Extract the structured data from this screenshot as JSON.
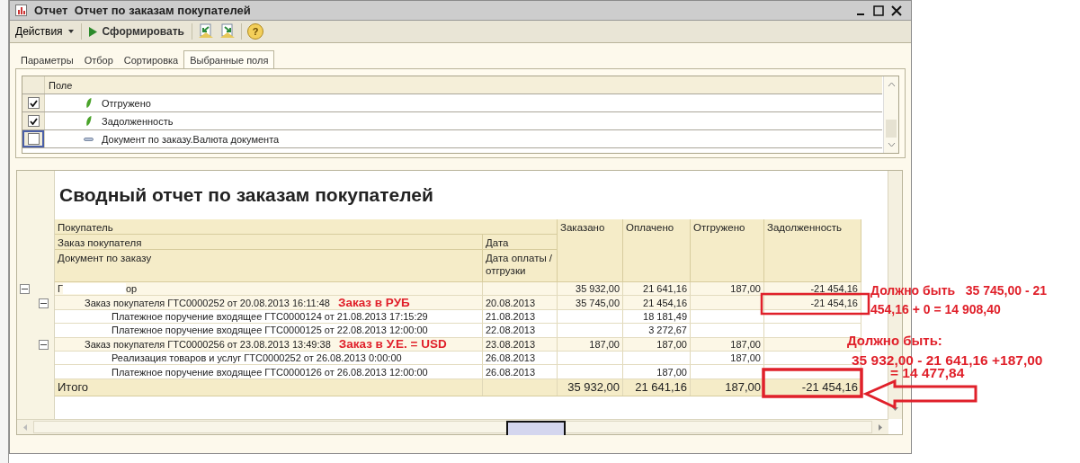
{
  "window": {
    "title": "Отчет  Отчет по заказам покупателей"
  },
  "toolbar": {
    "actions": "Действия",
    "generate": "Сформировать",
    "help": "?"
  },
  "tabs": [
    {
      "label": "Параметры",
      "selected": false
    },
    {
      "label": "Отбор",
      "selected": false
    },
    {
      "label": "Сортировка",
      "selected": false
    },
    {
      "label": "Выбранные поля",
      "selected": true
    }
  ],
  "fields": {
    "header": "Поле",
    "rows": [
      {
        "label": "Отгружено",
        "checked": true,
        "kind": "resource",
        "selected": false
      },
      {
        "label": "Задолженность",
        "checked": true,
        "kind": "resource",
        "selected": false
      },
      {
        "label": "Документ по заказу.Валюта документа",
        "checked": false,
        "kind": "attribute",
        "selected": true
      }
    ]
  },
  "report": {
    "title": "Сводный отчет по заказам покупателей",
    "header": {
      "customer": "Покупатель",
      "order": "Заказ покупателя",
      "date": "Дата",
      "document": "Документ по заказу",
      "doc_date": "Дата оплаты /отгрузки",
      "ordered": "Заказано",
      "paid": "Оплачено",
      "shipped": "Отгружено",
      "debt": "Задолженность"
    },
    "rows": [
      {
        "name_parts": [
          "Г",
          "ор"
        ],
        "ordered": "35 932,00",
        "paid": "21 641,16",
        "shipped": "187,00",
        "debt": "-21 454,16",
        "expanded": true,
        "children": [
          {
            "name": "Заказ покупателя ГТС0000252 от 20.08.2013 16:11:48",
            "note": "Заказ в РУБ",
            "date": "20.08.2013",
            "ordered": "35 745,00",
            "paid": "21 454,16",
            "debt": "-21 454,16",
            "expanded": true,
            "children": [
              {
                "name": "Платежное поручение входящее ГТС0000124 от 21.08.2013 17:15:29",
                "date": "21.08.2013",
                "paid": "18 181,49"
              },
              {
                "name": "Платежное поручение входящее ГТС0000125 от 22.08.2013 12:00:00",
                "date": "22.08.2013",
                "paid": "3 272,67"
              }
            ]
          },
          {
            "name": "Заказ покупателя ГТС0000256 от 23.08.2013 13:49:38",
            "note": "Заказ в У.Е. = USD",
            "date": "23.08.2013",
            "ordered": "187,00",
            "paid": "187,00",
            "shipped": "187,00",
            "expanded": true,
            "children": [
              {
                "name": "Реализация товаров и услуг ГТС0000252 от 26.08.2013 0:00:00",
                "date": "26.08.2013",
                "shipped": "187,00"
              },
              {
                "name": "Платежное поручение входящее ГТС0000126 от 26.08.2013 12:00:00",
                "date": "26.08.2013",
                "paid": "187,00"
              }
            ]
          }
        ]
      }
    ],
    "total": {
      "name": "Итого",
      "ordered": "35 932,00",
      "paid": "21 641,16",
      "shipped": "187,00",
      "debt": "-21 454,16"
    }
  },
  "annotations": {
    "note_1": "Должно быть   35 745,00 - 21 454,16 + 0 = 14 908,40",
    "note_2": [
      "Должно быть:",
      "35 932,00 - 21 641,16 +187,00",
      "= 14 477,84"
    ]
  }
}
